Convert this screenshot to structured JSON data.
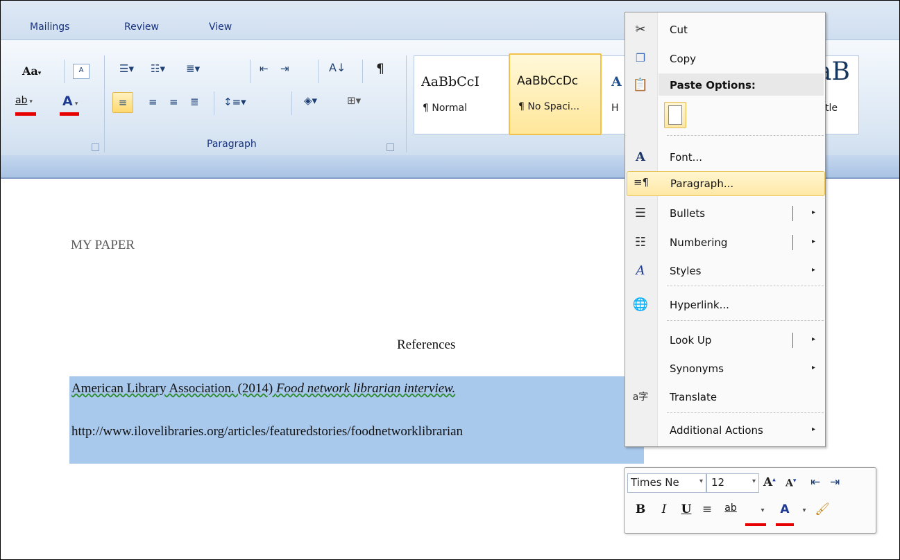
{
  "ribbon": {
    "tabs": [
      "Mailings",
      "Review",
      "View"
    ],
    "font_group": {
      "change_case": "Aa",
      "highlight": "ab",
      "font_color": "A"
    },
    "paragraph_group_label": "Paragraph",
    "styles": [
      {
        "sample": "AaBbCcI",
        "name": "¶ Normal"
      },
      {
        "sample": "AaBbCcDc",
        "name": "¶ No Spaci..."
      },
      {
        "sample": "A",
        "name": "H"
      },
      {
        "sample": "aB",
        "name": "Title"
      }
    ],
    "colors": {
      "highlight_bar": "#e60000",
      "font_color_bar": "#e60000",
      "selected_style_border": "#f2c14b"
    }
  },
  "document": {
    "heading": "MY PAPER",
    "references_title": "References",
    "ref_line1_normal": "American Library Association.  (2014) ",
    "ref_line1_italic": "Food network librarian interview.",
    "ref_line2": "http://www.ilovelibraries.org/articles/featuredstories/foodnetworklibrarian"
  },
  "context_menu": {
    "cut": "Cut",
    "copy": "Copy",
    "paste_options": "Paste Options:",
    "font": "Font...",
    "paragraph": "Paragraph...",
    "bullets": "Bullets",
    "numbering": "Numbering",
    "styles": "Styles",
    "hyperlink": "Hyperlink...",
    "look_up": "Look Up",
    "synonyms": "Synonyms",
    "translate": "Translate",
    "additional_actions": "Additional Actions",
    "arrow": "▸",
    "highlighted_item": "Paragraph..."
  },
  "mini_toolbar": {
    "font_name": "Times Ne",
    "font_size": "12",
    "bold": "B",
    "italic": "I",
    "underline": "U",
    "highlight": "ab",
    "font_color": "A"
  }
}
